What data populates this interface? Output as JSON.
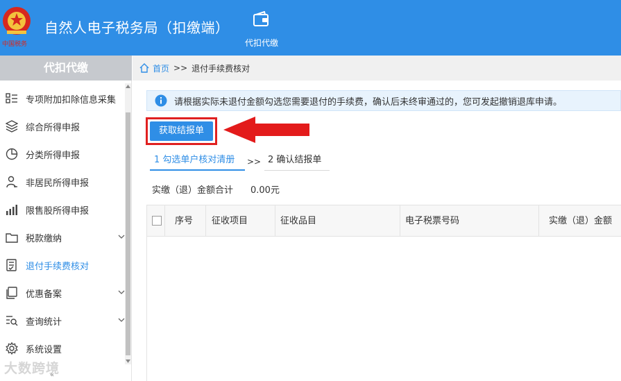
{
  "header": {
    "app_title": "自然人电子税务局（扣缴端）",
    "nav_items": [
      {
        "label": "代扣代缴",
        "icon": "wallet-icon"
      }
    ],
    "colors": {
      "header_bg": "#2f8ee6",
      "accent": "#2f8ee6",
      "highlight": "#e02020"
    }
  },
  "sidebar": {
    "title": "代扣代缴",
    "items": [
      {
        "label": "专项附加扣除信息采集",
        "icon": "list-icon",
        "has_submenu": false
      },
      {
        "label": "综合所得申报",
        "icon": "layers-icon",
        "has_submenu": false
      },
      {
        "label": "分类所得申报",
        "icon": "pie-icon",
        "has_submenu": false
      },
      {
        "label": "非居民所得申报",
        "icon": "person-icon",
        "has_submenu": false
      },
      {
        "label": "限售股所得申报",
        "icon": "bar-chart-icon",
        "has_submenu": false
      },
      {
        "label": "税款缴纳",
        "icon": "folder-icon",
        "has_submenu": true
      },
      {
        "label": "退付手续费核对",
        "icon": "document-check-icon",
        "has_submenu": false,
        "active": true
      },
      {
        "label": "优惠备案",
        "icon": "copy-icon",
        "has_submenu": true
      },
      {
        "label": "查询统计",
        "icon": "search-list-icon",
        "has_submenu": true
      },
      {
        "label": "系统设置",
        "icon": "gear-icon",
        "has_submenu": false
      }
    ],
    "watermark": "大数跨境",
    "collapse_label": "«"
  },
  "breadcrumb": {
    "home": "首页",
    "separator": ">>",
    "current": "退付手续费核对"
  },
  "notice": {
    "text": "请根据实际未退付金额勾选您需要退付的手续费，确认后未终审通过的，您可发起撤销退库申请。"
  },
  "actions": {
    "fetch_button": "获取结报单"
  },
  "steps": [
    {
      "label": "1 勾选单户核对清册",
      "active": true
    },
    {
      "label": "2 确认结报单",
      "active": false
    }
  ],
  "step_separator": ">>",
  "summary": {
    "label": "实缴（退）金额合计",
    "value": "0.00元"
  },
  "table": {
    "columns": [
      "序号",
      "征收项目",
      "征收品目",
      "电子税票号码",
      "实缴（退）金额"
    ],
    "rows": []
  }
}
